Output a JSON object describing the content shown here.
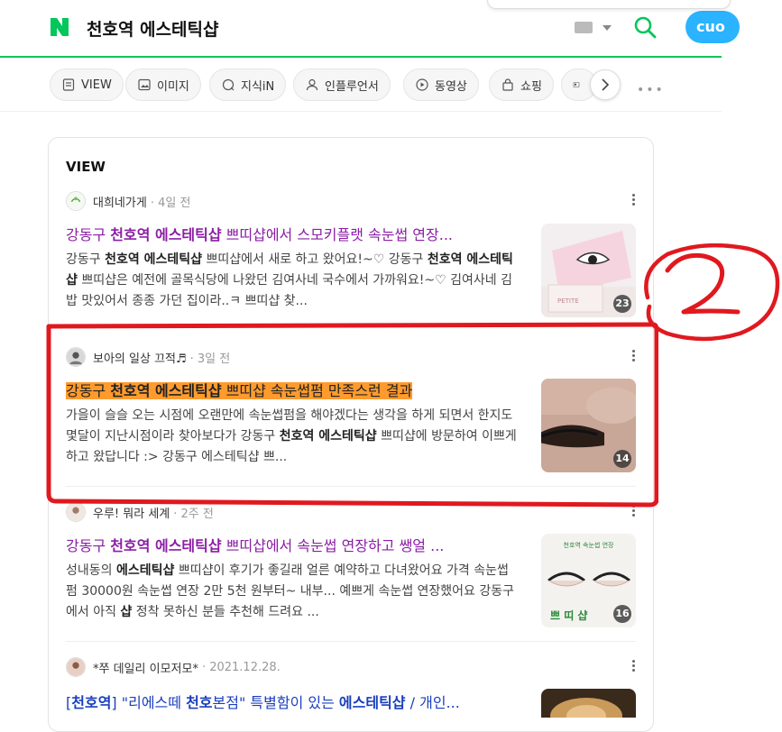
{
  "header": {
    "logo_letter": "N",
    "query": "천호역 에스테틱샵",
    "brand_color": "#03c75a",
    "pill_text": "cuo"
  },
  "tabs": [
    {
      "label": "VIEW",
      "icon": "doc-icon"
    },
    {
      "label": "이미지",
      "icon": "image-icon"
    },
    {
      "label": "지식iN",
      "icon": "qa-icon"
    },
    {
      "label": "인플루언서",
      "icon": "person-icon"
    },
    {
      "label": "동영상",
      "icon": "play-icon"
    },
    {
      "label": "쇼핑",
      "icon": "bag-icon"
    }
  ],
  "section": {
    "title": "VIEW"
  },
  "items": [
    {
      "author": "대희네가게",
      "date": "4일 전",
      "title_pre": "강동구 ",
      "title_bold": "천호역 에스테틱샵",
      "title_post": " 쁘띠샵에서 스모키플랫 속눈썹 연장...",
      "desc_1": "강동구 ",
      "desc_1b": "천호역 에스테틱샵",
      "desc_1c": " 쁘띠샵에서 새로 하고 왔어요!~♡ 강동구 ",
      "desc_2b": "천호역 에스테틱샵",
      "desc_2c": " 쁘띠샵은 예전에 골목식당에 나왔던 김여사네 국수에서 가까워요!~♡ 김여사네 김밥 맛있어서 종종 가던 집이라..ㅋ 쁘띠샵 찾...",
      "count": "23"
    },
    {
      "author": "보아의 일상 끄적♬",
      "date": "3일 전",
      "title_pre": "강동구 ",
      "title_bold": "천호역 에스테틱샵",
      "title_post": " 쁘띠샵 속눈썹펌 만족스런 결과",
      "desc_a": "가을이 슬슬 오는 시점에 오랜만에 속눈썹펌을 해야겠다는 생각을 하게 되면서 한지도 몇달이 지난시점이라 찾아보다가 강동구 ",
      "desc_b": "천호역 에스테틱샵",
      "desc_c": " 쁘띠샵에 방문하여 이쁘게 하고 왔답니다 :> 강동구 에스테틱샵 쁘...",
      "count": "14"
    },
    {
      "author": "우루! 뭐라 세계",
      "date": "2주 전",
      "title_pre": "강동구 ",
      "title_bold": "천호역 에스테틱샵",
      "title_post": " 쁘띠샵에서 속눈썹 연장하고 쌩얼 ...",
      "desc_a": "성내동의 ",
      "desc_b": "에스테틱샵",
      "desc_c": " 쁘띠샵이 후기가 좋길래 얼른 예약하고 다녀왔어요 가격 속눈썹 펌 30000원 속눈썹 연장 2만 5천 원부터~ 내부... 예쁘게 속눈썹 연장했어요 강동구에서 아직 ",
      "desc_d": "샵",
      "desc_e": " 정착 못하신 분들 추천해 드려요 ...",
      "thumb_text_top": "천호역 속눈썹 연장",
      "thumb_text_bottom": "쁘 띠 샵",
      "count": "16"
    },
    {
      "author": "*쭈 데일리 이모저모*",
      "date": "2021.12.28.",
      "title_1": "[",
      "title_2": "천호역",
      "title_3": "] \"리에스떼 ",
      "title_4": "천호",
      "title_5": "본점\" 특별함이 있는 ",
      "title_6": "에스테틱샵",
      "title_7": " / 개인..."
    }
  ],
  "annotation": {
    "color": "#e0191f",
    "label": "2"
  }
}
